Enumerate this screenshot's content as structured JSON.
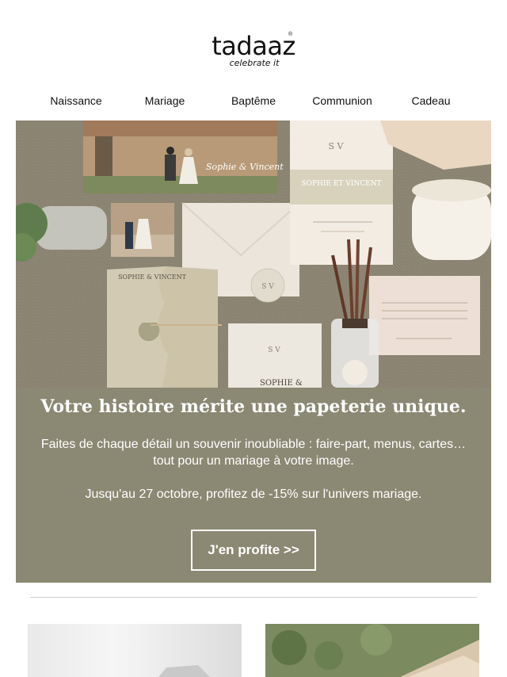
{
  "brand": {
    "name": "tadaaz",
    "tagline": "celebrate it",
    "reg": "®"
  },
  "nav": [
    {
      "label": "Naissance"
    },
    {
      "label": "Mariage"
    },
    {
      "label": "Baptême"
    },
    {
      "label": "Communion"
    },
    {
      "label": "Cadeau"
    }
  ],
  "hero": {
    "names_photo": "Sophie & Vincent",
    "names_card": "SOPHIE ET VINCENT",
    "monogram": "S V",
    "names_wrap": "SOPHIE & VINCENT",
    "names_bottom": "SOPHIE &"
  },
  "promo": {
    "title": "Votre histoire mérite une papeterie unique.",
    "text": "Faites de chaque détail un souvenir inoubliable : faire-part, menus, cartes… tout pour un mariage à votre image.",
    "offer": "Jusqu'au 27 octobre, profitez de -15% sur l'univers mariage.",
    "cta_label": "J'en profite >>"
  },
  "colors": {
    "promo_bg": "#8b8873",
    "text": "#111111",
    "white": "#ffffff"
  }
}
